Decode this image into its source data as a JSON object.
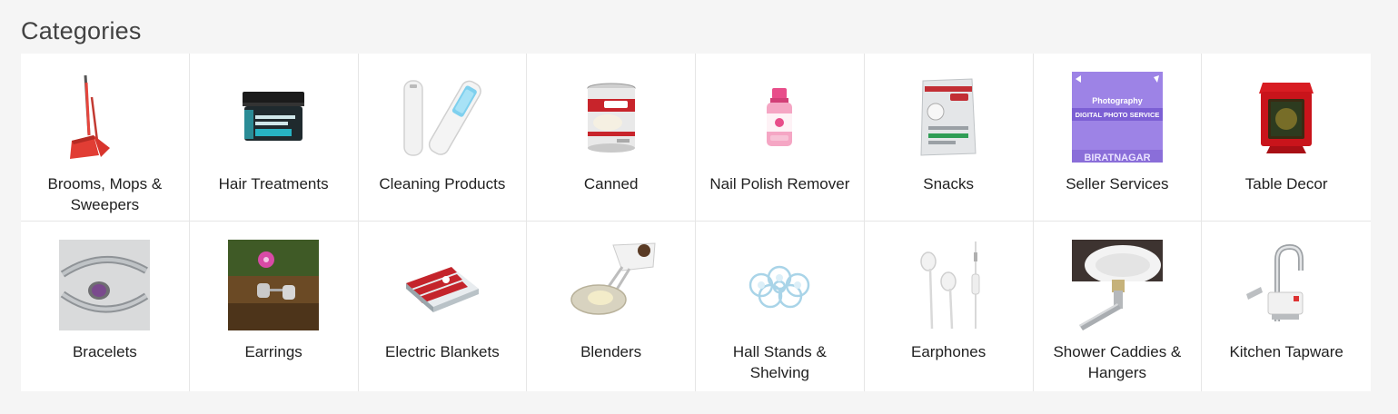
{
  "section": {
    "title": "Categories"
  },
  "categories": [
    {
      "label": "Brooms, Mops & Sweepers",
      "icon": "broom-dustpan-icon"
    },
    {
      "label": "Hair Treatments",
      "icon": "hair-cream-jar-icon"
    },
    {
      "label": "Cleaning Products",
      "icon": "uv-sterilizer-wand-icon"
    },
    {
      "label": "Canned",
      "icon": "condensed-milk-can-icon"
    },
    {
      "label": "Nail Polish Remover",
      "icon": "nail-polish-remover-bottle-icon"
    },
    {
      "label": "Snacks",
      "icon": "snack-pouch-icon"
    },
    {
      "label": "Seller Services",
      "icon": "photography-service-banner-icon",
      "banner_lines": [
        "Photography",
        "DIGITAL PHOTO SERVICE",
        "BIRATNAGAR"
      ]
    },
    {
      "label": "Table Decor",
      "icon": "red-decor-frame-box-icon"
    },
    {
      "label": "Bracelets",
      "icon": "silver-bracelet-icon"
    },
    {
      "label": "Earrings",
      "icon": "stud-earrings-icon"
    },
    {
      "label": "Electric Blankets",
      "icon": "electric-blanket-icon"
    },
    {
      "label": "Blenders",
      "icon": "hand-mixer-icon"
    },
    {
      "label": "Hall Stands & Shelving",
      "icon": "cake-stand-icon"
    },
    {
      "label": "Earphones",
      "icon": "white-earphones-icon"
    },
    {
      "label": "Shower Caddies & Hangers",
      "icon": "sink-drain-icon"
    },
    {
      "label": "Kitchen Tapware",
      "icon": "electric-faucet-icon"
    }
  ],
  "colors": {
    "page_background": "#f5f5f5",
    "card_background": "#ffffff",
    "divider": "#e6e6e6",
    "title_text": "#424242",
    "label_text": "#212121"
  }
}
